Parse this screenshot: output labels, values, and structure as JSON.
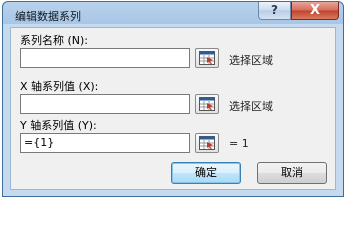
{
  "dialog": {
    "title": "编辑数据系列",
    "help_label": "?",
    "close_label": "X"
  },
  "series_name": {
    "label": "系列名称 (N):",
    "value": "",
    "hint": "选择区域"
  },
  "x_values": {
    "label": "X 轴系列值 (X):",
    "value": "",
    "hint": "选择区域"
  },
  "y_values": {
    "label": "Y 轴系列值 (Y):",
    "value": "={1}",
    "hint": "= 1"
  },
  "buttons": {
    "ok_label": "确定",
    "cancel_label": "取消"
  }
}
